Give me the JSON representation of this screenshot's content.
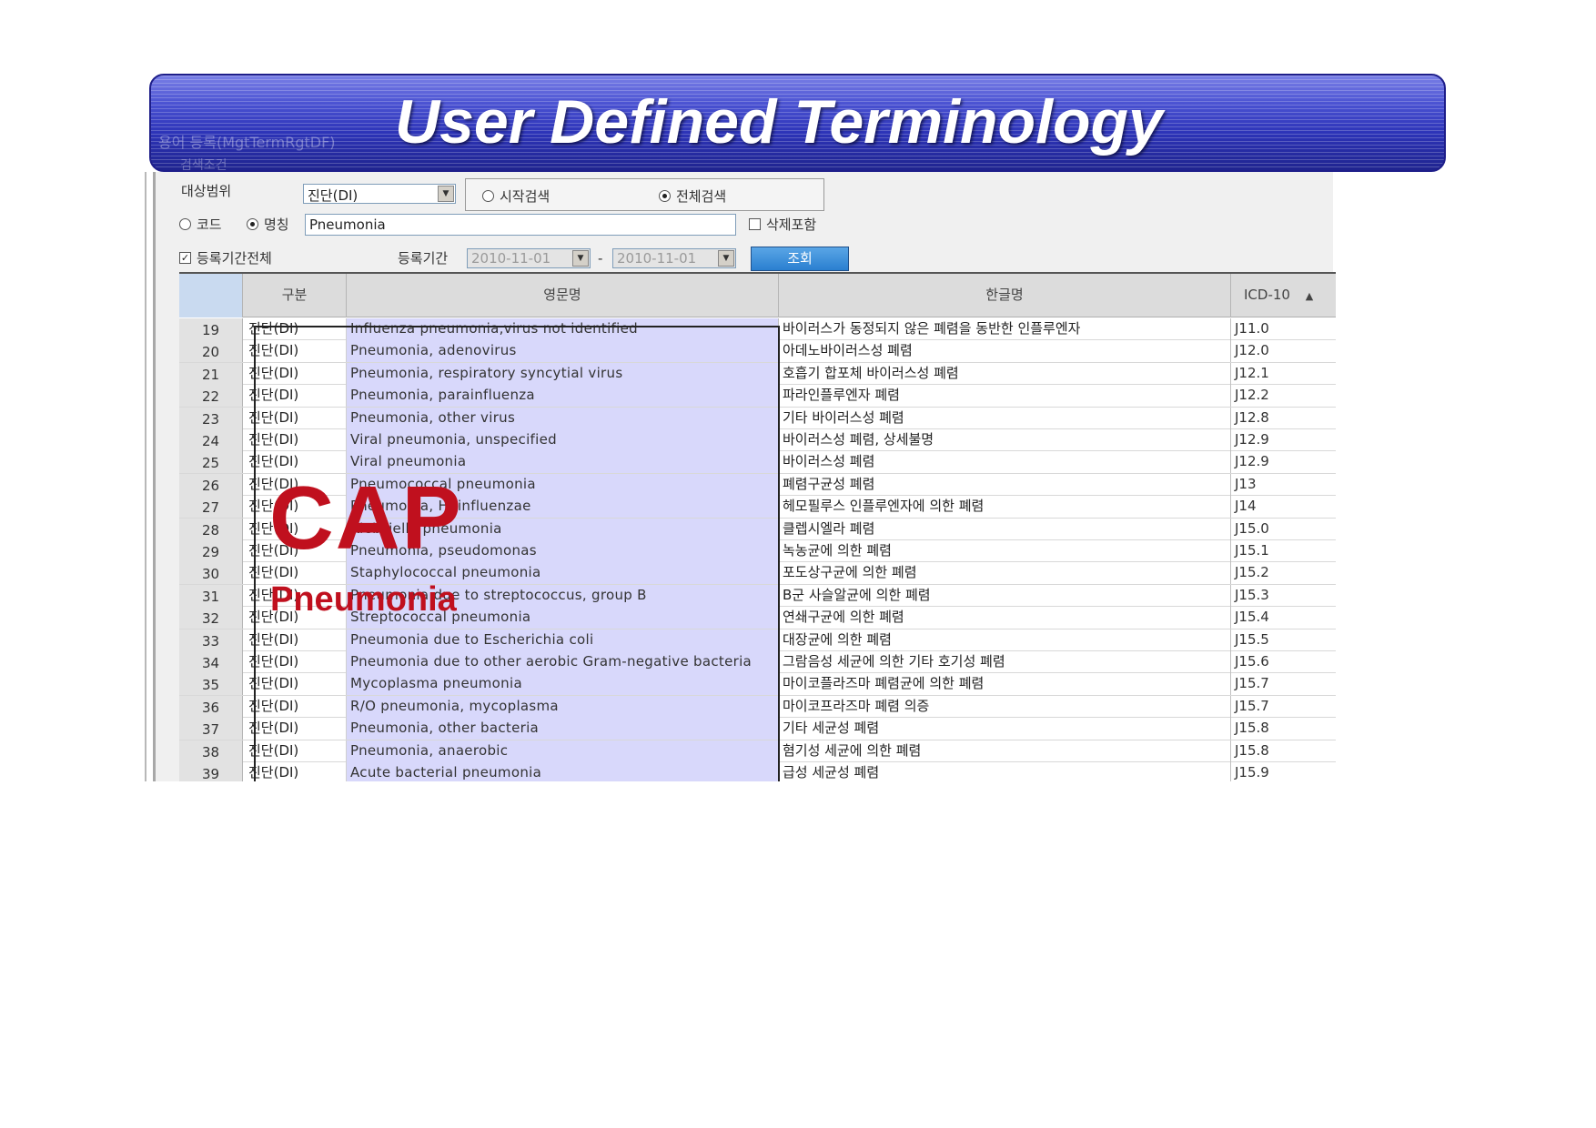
{
  "banner": {
    "title": "User Defined  Terminology",
    "ghost_text": "용어 등록(MgtTermRgtDF)",
    "ghost_text2": "검색조건"
  },
  "form": {
    "target_range_label": "대상범위",
    "target_range_value": "진단(DI)",
    "search_mode": {
      "start_label": "시작검색",
      "full_label": "전체검색",
      "selected": "full"
    },
    "code_label": "코드",
    "name_label": "명칭",
    "name_selected": true,
    "search_value": "Pneumonia",
    "include_deleted_label": "삭제포함",
    "all_period_label": "등록기간전체",
    "all_period_checked": true,
    "period_label": "등록기간",
    "date_from": "2010-11-01",
    "date_sep": "-",
    "date_to": "2010-11-01",
    "query_label": "조회"
  },
  "grid": {
    "headers": {
      "type": "구분",
      "english": "영문명",
      "korean": "한글명",
      "icd": "ICD-10",
      "sort_icon": "sort-up-icon"
    },
    "rows": [
      {
        "num": "19",
        "type": "진단(DI)",
        "english": "Influenza pneumonia,virus not identified",
        "korean": "바이러스가 동정되지 않은 폐렴을 동반한 인플루엔자",
        "icd": "J11.0"
      },
      {
        "num": "20",
        "type": "진단(DI)",
        "english": "Pneumonia, adenovirus",
        "korean": "아데노바이러스성 폐렴",
        "icd": "J12.0"
      },
      {
        "num": "21",
        "type": "진단(DI)",
        "english": "Pneumonia, respiratory syncytial virus",
        "korean": "호흡기 합포체 바이러스성 폐렴",
        "icd": "J12.1"
      },
      {
        "num": "22",
        "type": "진단(DI)",
        "english": "Pneumonia, parainfluenza",
        "korean": "파라인플루엔자 폐렴",
        "icd": "J12.2"
      },
      {
        "num": "23",
        "type": "진단(DI)",
        "english": "Pneumonia, other virus",
        "korean": "기타 바이러스성 폐렴",
        "icd": "J12.8"
      },
      {
        "num": "24",
        "type": "진단(DI)",
        "english": "Viral pneumonia, unspecified",
        "korean": "바이러스성 폐렴, 상세불명",
        "icd": "J12.9"
      },
      {
        "num": "25",
        "type": "진단(DI)",
        "english": "Viral pneumonia",
        "korean": "바이러스성 폐렴",
        "icd": "J12.9"
      },
      {
        "num": "26",
        "type": "진단(DI)",
        "english": "Pneumococcal pneumonia",
        "korean": "폐렴구균성 폐렴",
        "icd": "J13"
      },
      {
        "num": "27",
        "type": "진단(DI)",
        "english": "Pneumonia, H. influenzae",
        "korean": "헤모필루스 인플루엔자에 의한 폐렴",
        "icd": "J14"
      },
      {
        "num": "28",
        "type": "진단(DI)",
        "english": "Klebsiella pneumonia",
        "korean": "클렙시엘라 폐렴",
        "icd": "J15.0"
      },
      {
        "num": "29",
        "type": "진단(DI)",
        "english": "Pneumonia, pseudomonas",
        "korean": "녹농균에 의한 폐렴",
        "icd": "J15.1"
      },
      {
        "num": "30",
        "type": "진단(DI)",
        "english": "Staphylococcal pneumonia",
        "korean": "포도상구균에 의한 폐렴",
        "icd": "J15.2"
      },
      {
        "num": "31",
        "type": "진단(DI)",
        "english": "Pneumonia due to streptococcus, group B",
        "korean": "B군 사슬알균에 의한 폐렴",
        "icd": "J15.3"
      },
      {
        "num": "32",
        "type": "진단(DI)",
        "english": "Streptococcal pneumonia",
        "korean": "연쇄구균에 의한 폐렴",
        "icd": "J15.4"
      },
      {
        "num": "33",
        "type": "진단(DI)",
        "english": "Pneumonia due to Escherichia coli",
        "korean": "대장균에 의한 폐렴",
        "icd": "J15.5"
      },
      {
        "num": "34",
        "type": "진단(DI)",
        "english": "Pneumonia due to other aerobic Gram-negative bacteria",
        "korean": "그람음성 세균에 의한 기타 호기성 폐렴",
        "icd": "J15.6"
      },
      {
        "num": "35",
        "type": "진단(DI)",
        "english": "Mycoplasma pneumonia",
        "korean": "마이코플라즈마 폐렴균에 의한 폐렴",
        "icd": "J15.7"
      },
      {
        "num": "36",
        "type": "진단(DI)",
        "english": "R/O pneumonia, mycoplasma",
        "korean": "마이코프라즈마 폐렴 의증",
        "icd": "J15.7"
      },
      {
        "num": "37",
        "type": "진단(DI)",
        "english": "Pneumonia, other bacteria",
        "korean": "기타 세균성 폐렴",
        "icd": "J15.8"
      },
      {
        "num": "38",
        "type": "진단(DI)",
        "english": "Pneumonia, anaerobic",
        "korean": "혐기성 세균에 의한 폐렴",
        "icd": "J15.8"
      },
      {
        "num": "39",
        "type": "진단(DI)",
        "english": "Acute bacterial pneumonia",
        "korean": "급성 세균성 폐렴",
        "icd": "J15.9"
      }
    ]
  },
  "overlay": {
    "cap": "CAP",
    "subtitle": "Pneumonia",
    "color": "#c0101e"
  },
  "colors": {
    "banner": "#2d34b8",
    "selection_highlight": "#d8d8fb",
    "query_button": "#2a7fd0"
  }
}
